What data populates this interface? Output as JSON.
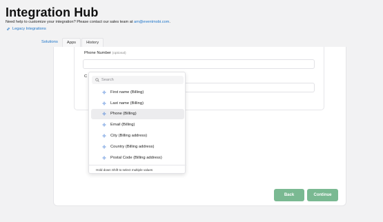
{
  "page": {
    "title": "Integration Hub",
    "subtitle_prefix": "Need help to customize your integration? Please contact our sales team at ",
    "sales_email": "am@eventmobi.com",
    "subtitle_suffix": ".",
    "legacy_link": "Legacy Integrations"
  },
  "tabs": [
    {
      "label": "Solutions",
      "active": true
    },
    {
      "label": "Apps",
      "active": false
    },
    {
      "label": "History",
      "active": false
    }
  ],
  "form": {
    "phone_label": "Phone Number",
    "phone_optional": "(optional)",
    "c_label": "C"
  },
  "dropdown": {
    "search_placeholder": "Search",
    "options": [
      {
        "label": "First name (Billing)",
        "icon": "sparkle-icon"
      },
      {
        "label": "Last name (Billing)",
        "icon": "sparkle-icon"
      },
      {
        "label": "Phone (Billing)",
        "icon": "sparkle-icon",
        "highlighted": true
      },
      {
        "label": "Email (Billing)",
        "icon": "sparkle-icon"
      },
      {
        "label": "City (Billing address)",
        "icon": "sparkle-icon"
      },
      {
        "label": "Country (Billing address)",
        "icon": "sparkle-icon"
      },
      {
        "label": "Postal Code (Billing address)",
        "icon": "sparkle-icon"
      }
    ],
    "hint": "Hold down  Shift  to select multiple values"
  },
  "footer": {
    "back_label": "Back",
    "continue_label": "Continue"
  },
  "colors": {
    "accent": "#1a73c8",
    "button": "#7ab992",
    "icon": "#2f6fd1"
  }
}
